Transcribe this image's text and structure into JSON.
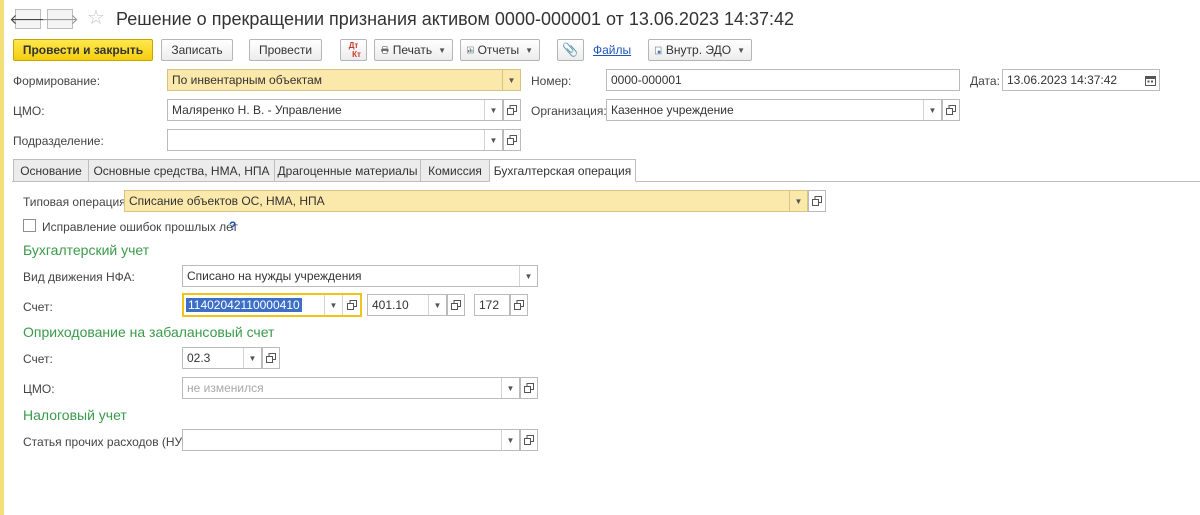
{
  "title": "Решение о прекращении признания активом 0000-000001 от 13.06.2023 14:37:42",
  "nav": {
    "back": "🡐",
    "forward": "🡒"
  },
  "toolbar": {
    "post_close": "Провести и закрыть",
    "save": "Записать",
    "post": "Провести",
    "dtkt_top": "Дт",
    "dtkt_bottom": "Кт",
    "print": "Печать",
    "reports": "Отчеты",
    "files": "Файлы",
    "edo": "Внутр. ЭДО"
  },
  "header": {
    "formation_label": "Формирование:",
    "formation_value": "По инвентарным объектам",
    "number_label": "Номер:",
    "number_value": "0000-000001",
    "date_label": "Дата:",
    "date_value": "13.06.2023 14:37:42",
    "cmo_label": "ЦМО:",
    "cmo_value": "Маляренко Н. В. - Управление",
    "org_label": "Организация:",
    "org_value": "Казенное учреждение",
    "dept_label": "Подразделение:",
    "dept_value": ""
  },
  "tabs": [
    {
      "label": "Основание"
    },
    {
      "label": "Основные средства, НМА, НПА"
    },
    {
      "label": "Драгоценные материалы"
    },
    {
      "label": "Комиссия"
    },
    {
      "label": "Бухгалтерская операция"
    }
  ],
  "operation": {
    "typical_label": "Типовая операция:",
    "typical_value": "Списание объектов ОС, НМА, НПА",
    "fix_errors_label": "Исправление ошибок прошлых лет",
    "fix_errors_checked": false,
    "help": "?"
  },
  "accounting": {
    "title": "Бухгалтерский учет",
    "movement_label": "Вид движения НФА:",
    "movement_value": "Списано на нужды учреждения",
    "account_label": "Счет:",
    "account_value": "11402042110000410",
    "account2_value": "401.10",
    "account3_value": "172"
  },
  "offbalance": {
    "title": "Оприходование на забалансовый счет",
    "account_label": "Счет:",
    "account_value": "02.3",
    "cmo_label": "ЦМО:",
    "cmo_placeholder": "не изменился"
  },
  "tax": {
    "title": "Налоговый учет",
    "expense_label": "Статья прочих расходов (НУ):",
    "expense_value": ""
  },
  "colors": {
    "accent_yellow": "#f4cd0f",
    "field_yellow": "#fbe8ab",
    "section_green": "#3a9b49",
    "link_blue": "#1f56b5"
  }
}
